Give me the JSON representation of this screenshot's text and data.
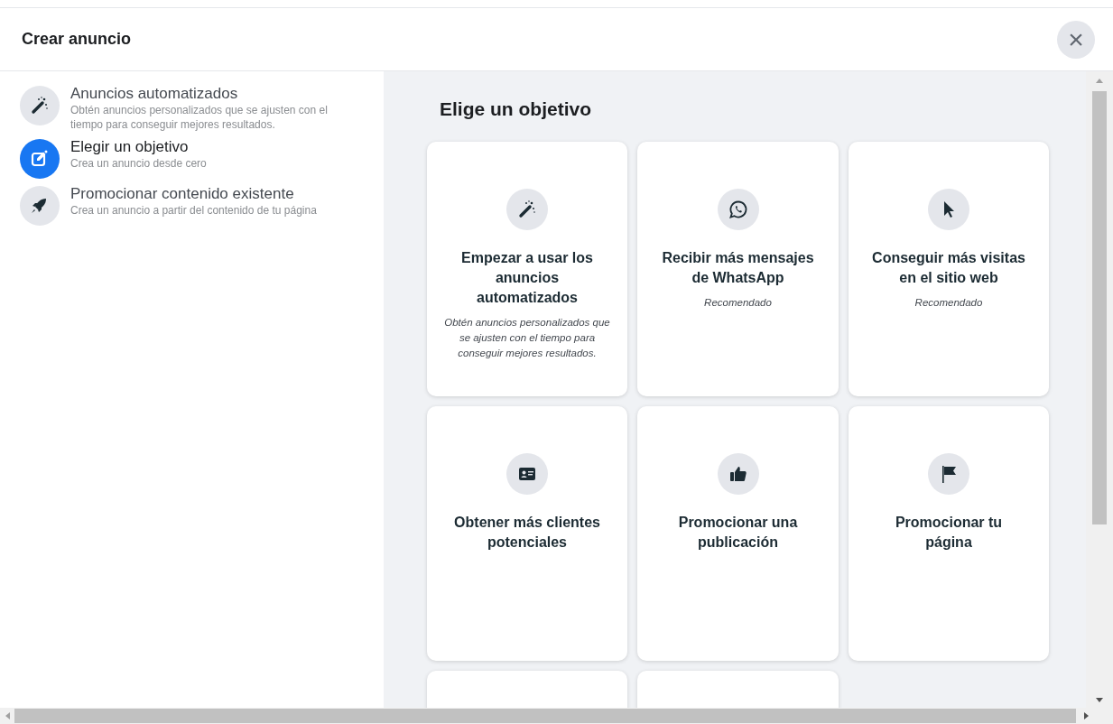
{
  "dialog": {
    "title": "Crear anuncio",
    "close_label": "×"
  },
  "sidebar": {
    "items": [
      {
        "title": "Anuncios automatizados",
        "description": "Obtén anuncios personalizados que se ajusten con el tiempo para conseguir mejores resultados.",
        "selected": false
      },
      {
        "title": "Elegir un objetivo",
        "description": "Crea un anuncio desde cero",
        "selected": true
      },
      {
        "title": "Promocionar contenido existente",
        "description": "Crea un anuncio a partir del contenido de tu página",
        "selected": false
      }
    ]
  },
  "objectives": {
    "heading": "Elige un objetivo",
    "cards": [
      {
        "kind": "full",
        "title": "Empezar a usar los anuncios automatizados",
        "note": "Obtén anuncios personalizados que se ajusten con el tiempo para conseguir mejores resultados."
      },
      {
        "kind": "full",
        "title": "Recibir más mensajes de WhatsApp",
        "note": "Recomendado"
      },
      {
        "kind": "full",
        "title": "Conseguir más visitas en el sitio web",
        "note": "Recomendado"
      },
      {
        "kind": "full",
        "title": "Obtener más clientes potenciales"
      },
      {
        "kind": "full",
        "title": "Promocionar una publicación"
      },
      {
        "kind": "full",
        "title": "Promocionar tu página"
      },
      {
        "kind": "cut_off"
      },
      {
        "kind": "cut_off"
      }
    ]
  }
}
